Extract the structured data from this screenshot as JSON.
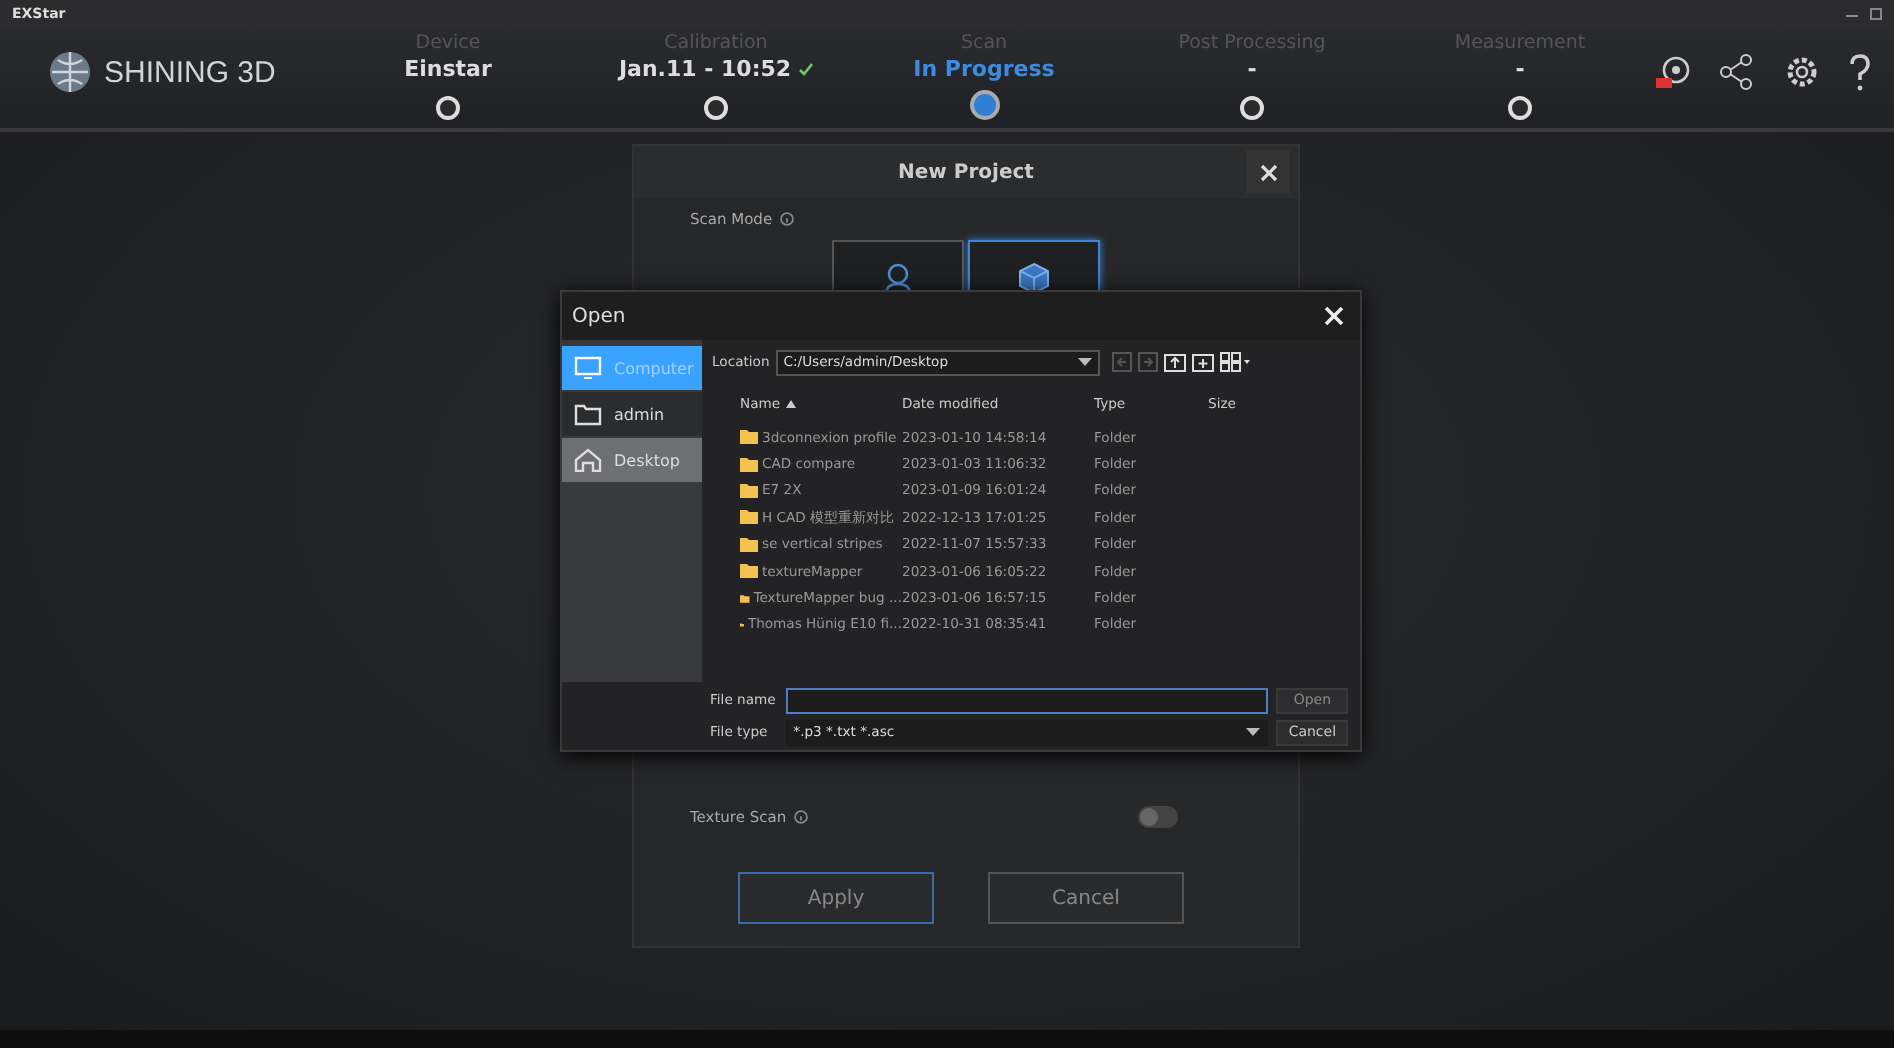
{
  "window": {
    "title": "EXStar"
  },
  "brand": {
    "name": "SHINING 3D"
  },
  "steps": [
    {
      "label": "Device",
      "value": "Einstar",
      "selected": false,
      "checked": false
    },
    {
      "label": "Calibration",
      "value": "Jan.11 - 10:52",
      "selected": false,
      "checked": true
    },
    {
      "label": "Scan",
      "value": "In Progress",
      "selected": true,
      "checked": false
    },
    {
      "label": "Post Processing",
      "value": "-",
      "selected": false,
      "checked": false
    },
    {
      "label": "Measurement",
      "value": "-",
      "selected": false,
      "checked": false
    }
  ],
  "new_project": {
    "title": "New Project",
    "scan_mode_label": "Scan Mode",
    "modes": [
      {
        "kind": "face",
        "selected": false
      },
      {
        "kind": "object",
        "selected": true
      }
    ],
    "texture_scan": {
      "label": "Texture Scan",
      "on": false
    },
    "buttons": [
      {
        "label": "Apply",
        "kind": "primary"
      },
      {
        "label": "Cancel",
        "kind": "secondary"
      }
    ]
  },
  "open_dialog": {
    "title": "Open",
    "places": [
      {
        "label": "Computer",
        "kind": "computer",
        "selected": true,
        "highlighted": false
      },
      {
        "label": "admin",
        "kind": "folder",
        "selected": false,
        "highlighted": false
      },
      {
        "label": "Desktop",
        "kind": "home",
        "selected": false,
        "highlighted": true
      }
    ],
    "location_label": "Location",
    "location": "C:/Users/admin/Desktop",
    "columns": [
      "Name",
      "Date modified",
      "Type",
      "Size"
    ],
    "rows": [
      {
        "name": "3dconnexion profile",
        "date": "2023-01-10 14:58:14",
        "type": "Folder"
      },
      {
        "name": "CAD compare",
        "date": "2023-01-03 11:06:32",
        "type": "Folder"
      },
      {
        "name": "E7 2X",
        "date": "2023-01-09 16:01:24",
        "type": "Folder"
      },
      {
        "name": "H CAD 模型重新对比",
        "date": "2022-12-13 17:01:25",
        "type": "Folder"
      },
      {
        "name": "se vertical stripes",
        "date": "2022-11-07 15:57:33",
        "type": "Folder"
      },
      {
        "name": "textureMapper",
        "date": "2023-01-06 16:05:22",
        "type": "Folder"
      },
      {
        "name": "TextureMapper bug ...",
        "date": "2023-01-06 16:57:15",
        "type": "Folder"
      },
      {
        "name": "Thomas Hünig E10 fi...",
        "date": "2022-10-31 08:35:41",
        "type": "Folder"
      }
    ],
    "file_name_label": "File name",
    "open_button": "Open",
    "file_type_label": "File type",
    "file_type": "*.p3  *.txt  *.asc",
    "cancel_button": "Cancel"
  }
}
